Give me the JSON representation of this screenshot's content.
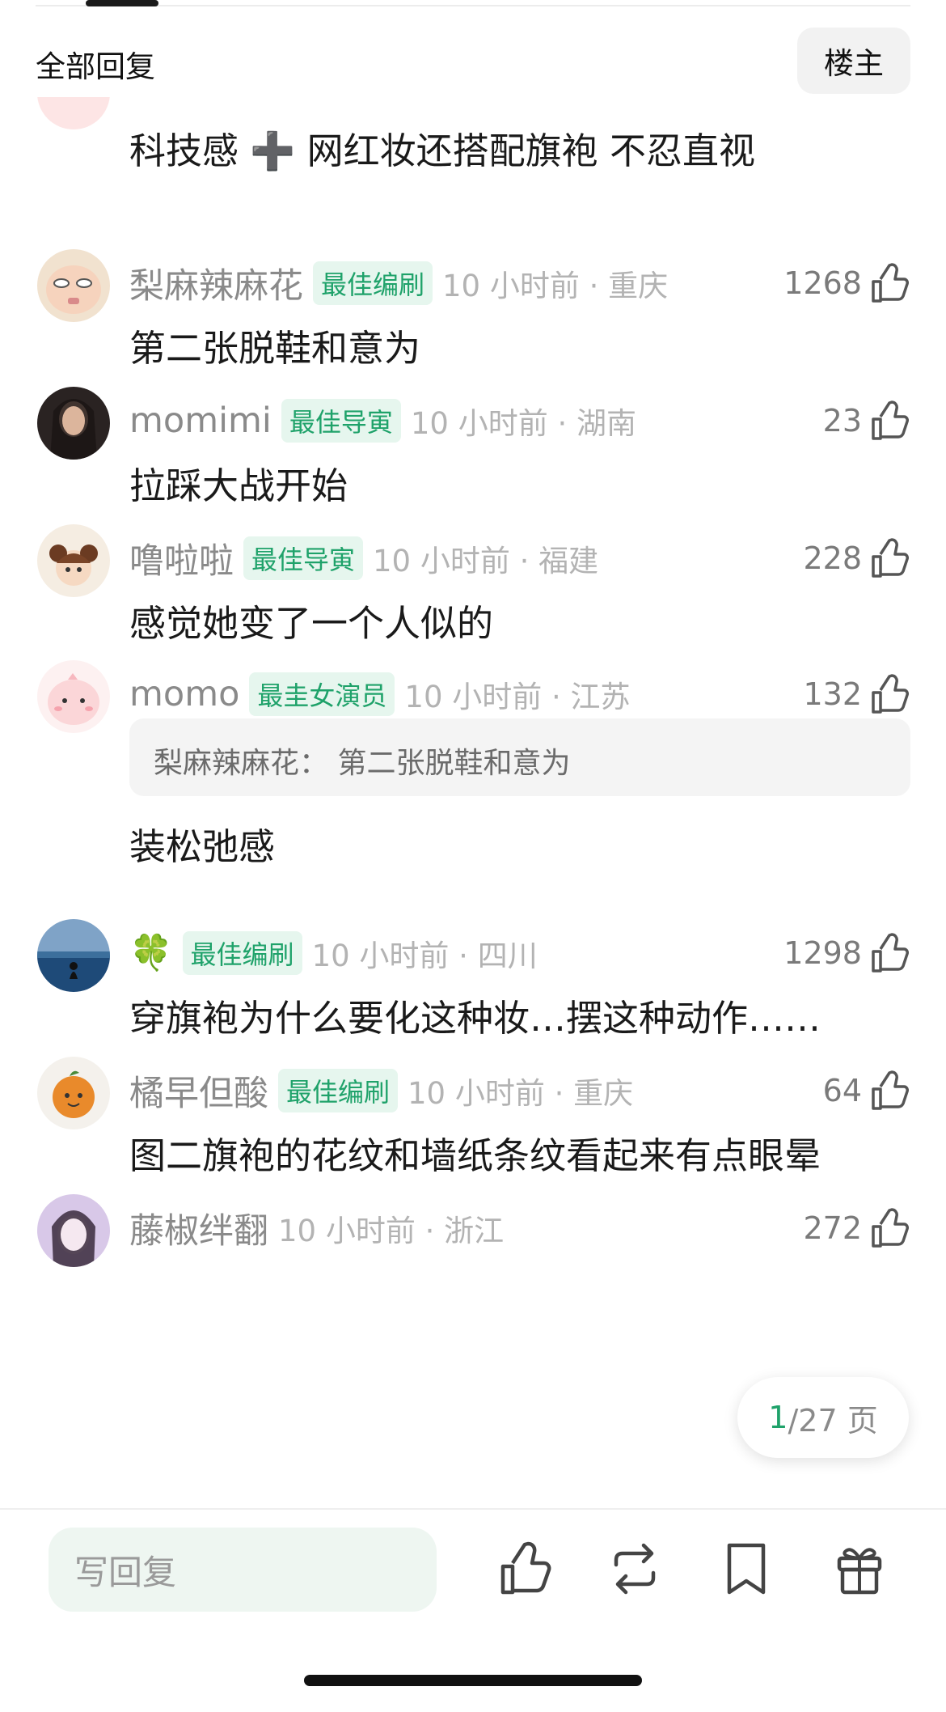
{
  "header": {
    "title": "全部回复",
    "owner_button": "楼主"
  },
  "top_snippet": {
    "text": "科技感 ➕ 网红妆还搭配旗袍 不忍直视"
  },
  "comments": [
    {
      "name": "梨麻辣麻花",
      "badge": "最佳编刷",
      "time": "10 小时前 · 重庆",
      "likes": "1268",
      "text": "第二张脱鞋和意为"
    },
    {
      "name": "momimi",
      "badge": "最佳导寅",
      "time": "10 小时前 · 湖南",
      "likes": "23",
      "text": "拉踩大战开始"
    },
    {
      "name": "噜啦啦",
      "badge": "最佳导寅",
      "time": "10 小时前 · 福建",
      "likes": "228",
      "text": "感觉她变了一个人似的"
    },
    {
      "name": "momo",
      "badge": "最圭女演员",
      "time": "10 小时前 · 江苏",
      "likes": "132",
      "quote": "梨麻辣麻花：  第二张脱鞋和意为",
      "text": "装松弛感"
    },
    {
      "name": "🍀",
      "badge": "最佳编刷",
      "time": "10 小时前 · 四川",
      "likes": "1298",
      "text": "穿旗袍为什么要化这种妆…摆这种动作……"
    },
    {
      "name": "橘早但酸",
      "badge": "最佳编刷",
      "time": "10 小时前 · 重庆",
      "likes": "64",
      "text": "图二旗袍的花纹和墙纸条纹看起来有点眼晕"
    },
    {
      "name": "藤椒绊翻",
      "time": "10 小时前 · 浙江",
      "likes": "272"
    }
  ],
  "pagination": {
    "current": "1",
    "rest": "/27 页"
  },
  "bottom_bar": {
    "reply_placeholder": "写回复"
  },
  "colors": {
    "accent_green": "#1fa26a",
    "badge_bg": "#e6f6ee",
    "muted_text": "#8a8a8a"
  }
}
